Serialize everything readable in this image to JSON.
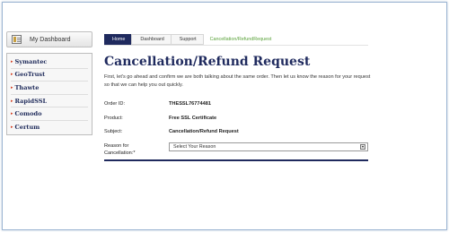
{
  "dashboard": {
    "label": "My Dashboard",
    "icon": "dashboard-icon"
  },
  "sidebar": {
    "items": [
      {
        "label": "Symantec"
      },
      {
        "label": "GeoTrust"
      },
      {
        "label": "Thawte"
      },
      {
        "label": "RapidSSL"
      },
      {
        "label": "Comodo"
      },
      {
        "label": "Certum"
      }
    ],
    "arrow": "▸"
  },
  "breadcrumb": {
    "items": [
      "Home",
      "Dashboard",
      "Support",
      "Cancellation/RefundRequest"
    ]
  },
  "page": {
    "title": "Cancellation/Refund Request",
    "intro": "First, let's go ahead and confirm we are both talking about the same order. Then let us know the reason for your request so that we can help you out quickly."
  },
  "form": {
    "order_id_label": "Order ID:",
    "order_id_value": "THESSL76774481",
    "product_label": "Product:",
    "product_value": "Free SSL Certificate",
    "subject_label": "Subject:",
    "subject_value": "Cancellation/Refund Request",
    "reason_label_line1": "Reason for",
    "reason_label_line2": "Cancellation:*",
    "reason_selected": "Select Your Reason",
    "reason_arrow": "▾"
  },
  "colors": {
    "navy": "#1f2a5e",
    "accent_red": "#d23a1c",
    "active_green": "#5aa23a"
  }
}
